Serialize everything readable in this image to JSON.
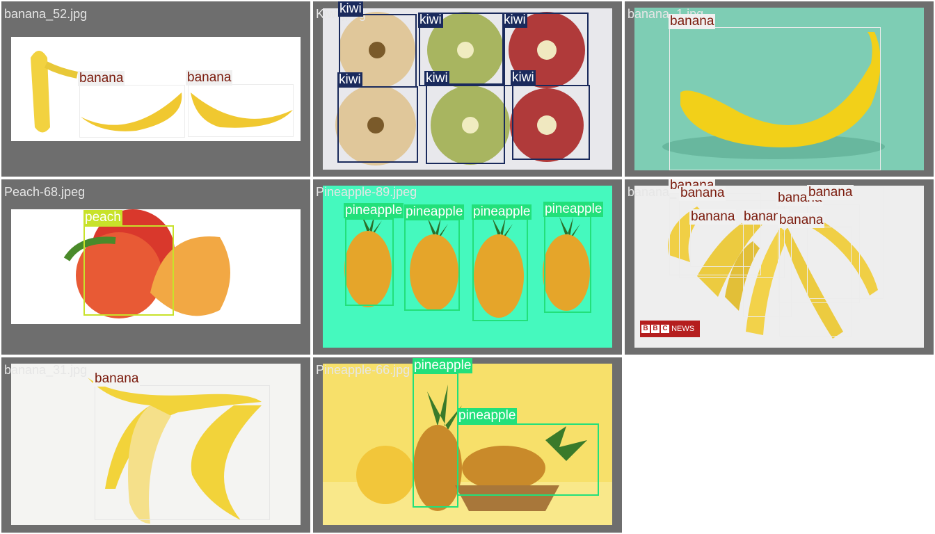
{
  "tiles": [
    {
      "filename": "banana_52.jpg",
      "labels": [
        "banana",
        "banana"
      ]
    },
    {
      "filename": "Kiwi.jpeg",
      "labels": [
        "kiwi",
        "kiwi",
        "kiwi",
        "kiwi",
        "kiwi",
        "kiwi"
      ]
    },
    {
      "filename": "banana_1.jpg",
      "labels": [
        "banana"
      ]
    },
    {
      "filename": "Peach-68.jpeg",
      "labels": [
        "peach"
      ]
    },
    {
      "filename": "Pineapple-89.jpeg",
      "labels": [
        "pineapple",
        "pineapple",
        "pineapple",
        "pineapple"
      ]
    },
    {
      "filename": "banana_",
      "labels": [
        "banana",
        "banana",
        "banana",
        "banana",
        "banana",
        "banana",
        "banana"
      ],
      "watermark": {
        "box": "B",
        "box2": "B",
        "box3": "C",
        "text": "NEWS"
      }
    },
    {
      "filename": "banana_31.jpg",
      "labels": [
        "banana"
      ]
    },
    {
      "filename": "Pineapple-66.jpg",
      "labels": [
        "pineapple",
        "pineapple"
      ]
    }
  ],
  "colors": {
    "tile_bg": "#6e6e6e",
    "banana_box": "#ececec",
    "banana_label_bg": "#f0f0f0",
    "banana_label_text": "#7a1a0c",
    "kiwi_box": "#1a2a5c",
    "pineapple_box": "#22e07a",
    "peach_box": "#c8e22a"
  }
}
